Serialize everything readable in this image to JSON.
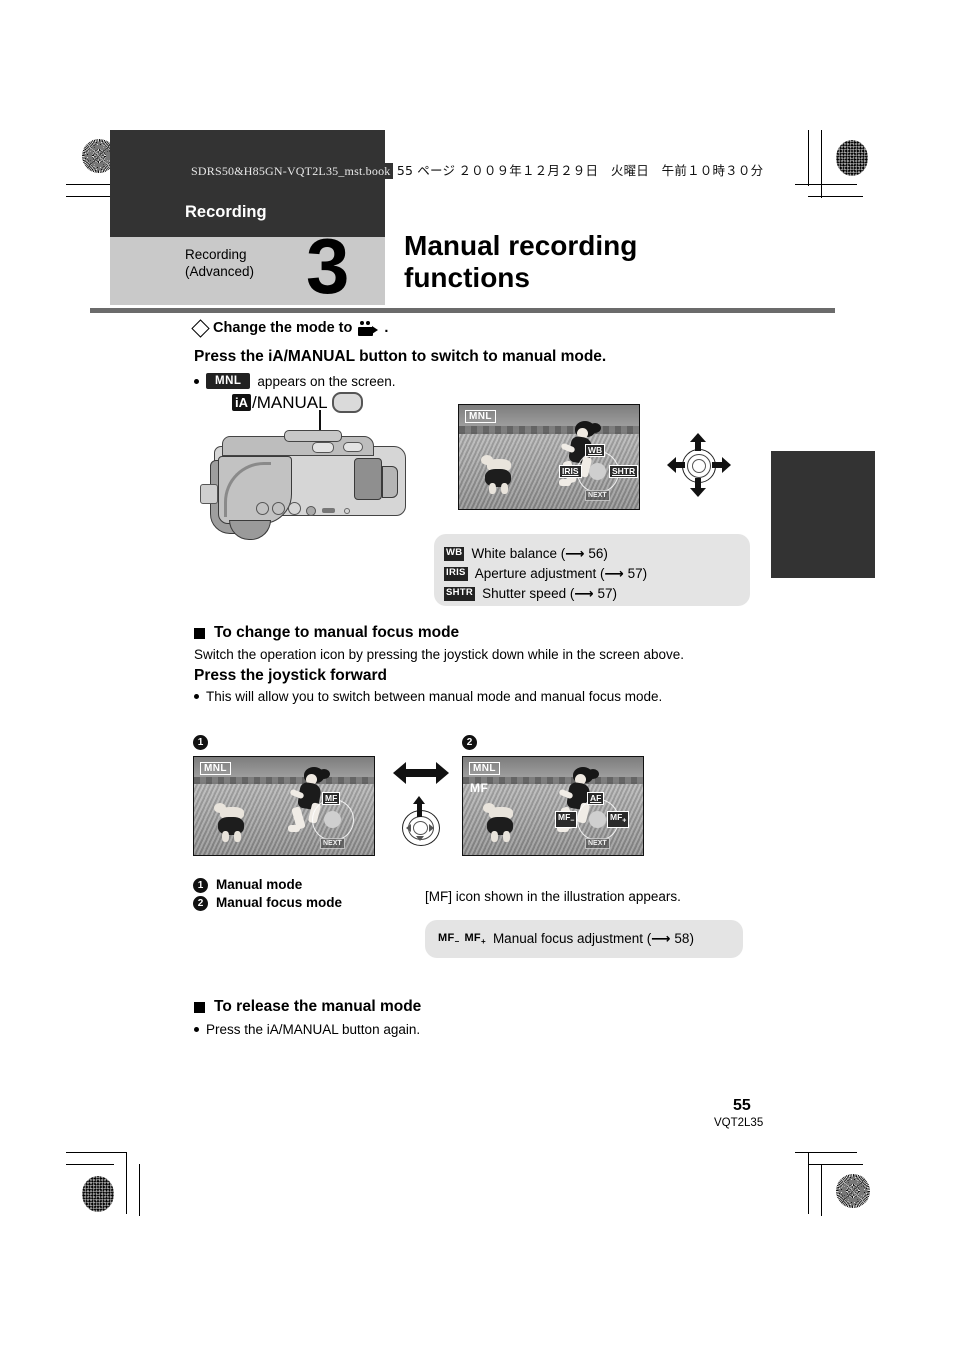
{
  "print_header": {
    "filename": "SDRS50&H85GN-VQT2L35_mst.book",
    "page_note": "55 ページ",
    "date_note": "２００９年１２月２９日　火曜日　午前１０時３０分"
  },
  "chapter": {
    "section_label": "Recording",
    "sub_label": "Recording\n(Advanced)",
    "sub_line1": "Recording",
    "sub_line2": "(Advanced)",
    "number": "3",
    "title": "Manual recording functions",
    "title_line1": "Manual recording",
    "title_line2": "functions"
  },
  "intro": {
    "mode_change": "Change the mode to",
    "mode_icon": "camcorder-icon",
    "mode_period": ".",
    "instruction": "Press the iA/MANUAL button to switch to manual mode.",
    "bullet_chip": "MNL",
    "bullet_text": "appears on the screen.",
    "button_label_ia": "iA",
    "button_label_manual": "/MANUAL"
  },
  "lcd_main": {
    "osd_mnl": "MNL",
    "icon_up": "WB",
    "icon_left": "IRIS",
    "icon_right": "SHTR",
    "icon_down": "NEXT"
  },
  "legend_main": {
    "rows": [
      {
        "icon": "WB",
        "text": "White balance (",
        "page": "56",
        "close": ")"
      },
      {
        "icon": "IRIS",
        "text": "Aperture adjustment (",
        "page": "57",
        "close": ")"
      },
      {
        "icon": "SHTR",
        "text": "Shutter speed (",
        "page": "57",
        "close": ")"
      }
    ]
  },
  "focus_section": {
    "heading": "To change to manual focus mode",
    "body": "Switch the operation icon by pressing the joystick down while in the screen above.",
    "subheading": "Press the joystick forward",
    "bullet": "This will allow you to switch between manual mode and manual focus mode."
  },
  "screen_one": {
    "badge": "1",
    "osd_mnl": "MNL",
    "icon_up": "MF",
    "icon_down": "NEXT"
  },
  "screen_two": {
    "badge": "2",
    "osd_mnl": "MNL",
    "osd_mf": "MF",
    "icon_up": "AF",
    "icon_left": "MF",
    "icon_left_sub": "−",
    "icon_right": "MF",
    "icon_right_sub": "+",
    "icon_down": "NEXT"
  },
  "captions": {
    "item1_num": "1",
    "item1": "Manual mode",
    "item2_num": "2",
    "item2": "Manual focus mode",
    "note": "[MF] icon shown in the illustration appears."
  },
  "legend_focus": {
    "icon_a": "MF",
    "icon_a_sub": "−",
    "icon_b": "MF",
    "icon_b_sub": "+",
    "text": "Manual focus adjustment (",
    "page": "58",
    "close": ")"
  },
  "release_section": {
    "heading": "To release the manual mode",
    "bullet": "Press the iA/MANUAL button again."
  },
  "footer": {
    "page_number": "55",
    "doc_code": "VQT2L35"
  },
  "colors": {
    "chapter_dark": "#333333",
    "chapter_light": "#c9c9c9",
    "rule": "#6b6b6b",
    "note_box": "#e4e4e4",
    "thumb_tab": "#333333"
  }
}
